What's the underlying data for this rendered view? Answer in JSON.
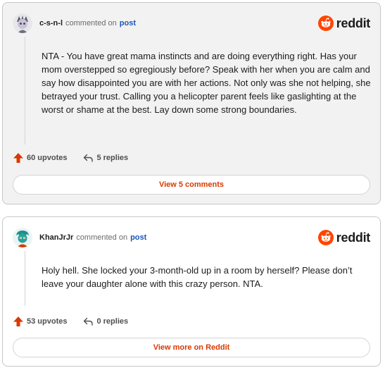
{
  "colors": {
    "reddit_orange": "#ff4500",
    "upvote": "#d93900",
    "link_blue": "#1a55b5",
    "action_text": "#d93900"
  },
  "brand": {
    "name": "reddit",
    "icon": "reddit-logo-icon"
  },
  "comments": [
    {
      "username": "c-s-n-l",
      "commented_on": "commented on",
      "post_link": "post",
      "avatar_icon": "avatar-icon",
      "body": "NTA - You have great mama instincts and are doing everything right. Has your mom overstepped so egregiously before? Speak with her when you are calm and say how disappointed you are with her actions. Not only was she not helping, she betrayed your trust. Calling you a helicopter parent feels like gaslighting at the worst or shame at the best. Lay down some strong boundaries.",
      "upvotes": "60 upvotes",
      "replies": "5 replies",
      "action": "View 5 comments"
    },
    {
      "username": "KhanJrJr",
      "commented_on": "commented on",
      "post_link": "post",
      "avatar_icon": "avatar-icon",
      "body": "Holy hell. She locked your 3-month-old up in a room by herself? Please don’t leave your daughter alone with this crazy person. NTA.",
      "upvotes": "53 upvotes",
      "replies": "0 replies",
      "action": "View more on Reddit"
    }
  ]
}
